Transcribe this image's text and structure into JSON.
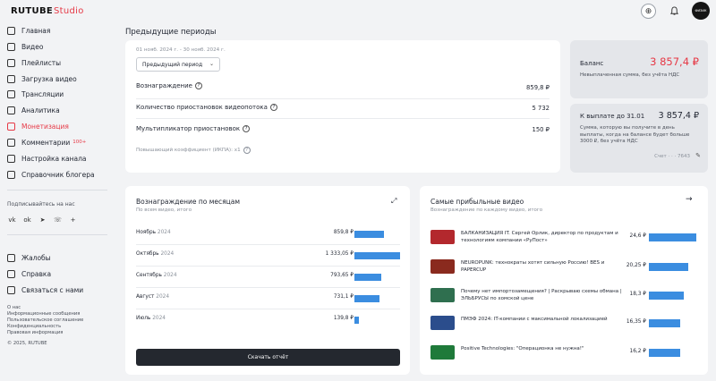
{
  "brand": {
    "name": "RUTUBE",
    "sub": "Studio"
  },
  "header": {
    "avatar_text": "ФИЗИК"
  },
  "sidebar": {
    "items": [
      {
        "label": "Главная",
        "icon": "home-icon"
      },
      {
        "label": "Видео",
        "icon": "video-icon"
      },
      {
        "label": "Плейлисты",
        "icon": "playlist-icon"
      },
      {
        "label": "Загрузка видео",
        "icon": "upload-icon"
      },
      {
        "label": "Трансляции",
        "icon": "broadcast-icon"
      },
      {
        "label": "Аналитика",
        "icon": "analytics-icon"
      },
      {
        "label": "Монетизация",
        "icon": "monetization-icon"
      },
      {
        "label": "Комментарии",
        "icon": "comments-icon",
        "badge": "100+"
      },
      {
        "label": "Настройка канала",
        "icon": "settings-icon"
      },
      {
        "label": "Справочник блогера",
        "icon": "guide-icon"
      }
    ],
    "subscribe_title": "Подписывайтесь на нас",
    "socials": [
      "vk",
      "ok",
      "tg",
      "viber",
      "plus"
    ],
    "bottom_items": [
      {
        "label": "Жалобы",
        "icon": "flag-icon"
      },
      {
        "label": "Справка",
        "icon": "help-icon"
      },
      {
        "label": "Связаться с нами",
        "icon": "mail-icon"
      }
    ],
    "footer_links": [
      "О нас",
      "Информационные сообщения",
      "Пользовательское соглашение",
      "Конфиденциальность",
      "Правовая информация",
      "© 2025, RUTUBE"
    ]
  },
  "previous": {
    "title": "Предыдущие периоды",
    "date_range": "01 нояб. 2024 г. - 30 нояб. 2024 г.",
    "select_value": "Предыдущий период",
    "reward_label": "Вознаграждение",
    "reward_value": "859,8 ₽",
    "ads_label": "Количество приостановок видеопотока",
    "ads_value": "5 732",
    "mult_label": "Мультипликатор приостановок",
    "mult_value": "150 ₽",
    "coef_label": "Повышающий коэффициент (ИКПА): x1"
  },
  "balance": {
    "label": "Баланс",
    "value": "3 857,4 ₽",
    "note": "Невыплаченная сумма, без учёта НДС"
  },
  "payout": {
    "label": "К выплате до 31.01",
    "value": "3 857,4 ₽",
    "note": "Сумма, которую вы получите в день выплаты, когда на балансе будет больше 3000 ₽, без учёта НДС",
    "account": "Счет · · · 7643"
  },
  "monthly": {
    "title": "Вознаграждение по месяцам",
    "subtitle": "По всем видео, итого",
    "rows": [
      {
        "month": "Ноябрь",
        "year": "2024",
        "amount": "859,8 ₽",
        "fraction": 0.645
      },
      {
        "month": "Октябрь",
        "year": "2024",
        "amount": "1 333,05 ₽",
        "fraction": 1.0
      },
      {
        "month": "Сентябрь",
        "year": "2024",
        "amount": "793,65 ₽",
        "fraction": 0.595
      },
      {
        "month": "Август",
        "year": "2024",
        "amount": "731,1 ₽",
        "fraction": 0.548
      },
      {
        "month": "Июль",
        "year": "2024",
        "amount": "139,8 ₽",
        "fraction": 0.105
      }
    ],
    "download_label": "Скачать отчёт"
  },
  "top_videos": {
    "title": "Самые прибыльные видео",
    "subtitle": "Вознаграждение по каждому видео, итого",
    "rows": [
      {
        "title": "БАЛКАНИЗАЦИЯ IT. Сергей Орлик, директор по продуктам и технологиям компании «РуПост»",
        "amount": "24,6 ₽",
        "fraction": 1.0,
        "thumb_color": "#b3282d"
      },
      {
        "title": "NEUROPUNK: технократы хотят сильную Россию! BES и PAPERCUP",
        "amount": "20,25 ₽",
        "fraction": 0.823,
        "thumb_color": "#8a2a1e"
      },
      {
        "title": "Почему нет импортозамещения? | Раскрываю схемы обмана | ЭЛЬБРУСЫ по хомской цене",
        "amount": "18,3 ₽",
        "fraction": 0.744,
        "thumb_color": "#2f6f4f"
      },
      {
        "title": "ПМЭФ 2024: IT-компании с максимальной локализацией",
        "amount": "16,35 ₽",
        "fraction": 0.665,
        "thumb_color": "#2b4d8c"
      },
      {
        "title": "Positive Technologies: \"Операционка не нужна!\"",
        "amount": "16,2 ₽",
        "fraction": 0.659,
        "thumb_color": "#1f7a3a"
      }
    ]
  }
}
